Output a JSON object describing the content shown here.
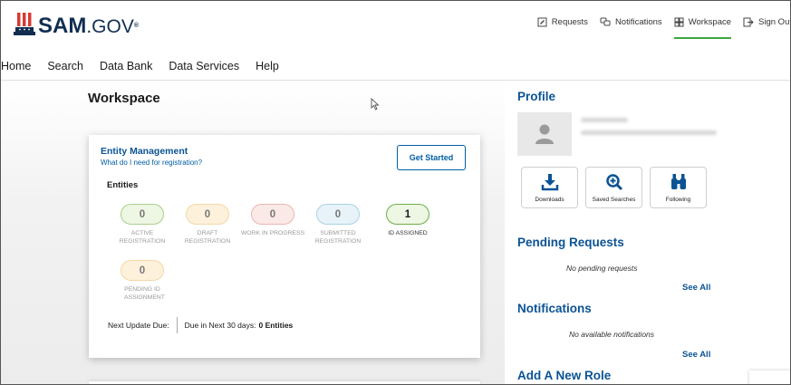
{
  "header": {
    "logo_text": "SAM",
    "logo_suffix": ".GOV",
    "logo_mark": "®",
    "top_links": [
      {
        "label": "Requests",
        "icon": "requests-icon"
      },
      {
        "label": "Notifications",
        "icon": "notifications-icon"
      },
      {
        "label": "Workspace",
        "icon": "workspace-icon",
        "active": true
      },
      {
        "label": "Sign Out",
        "icon": "sign-out-icon"
      }
    ]
  },
  "mainnav": [
    "Home",
    "Search",
    "Data Bank",
    "Data Services",
    "Help"
  ],
  "workspace": {
    "title": "Workspace",
    "entity_card": {
      "title": "Entity Management",
      "link": "What do I need for registration?",
      "button": "Get Started",
      "section": "Entities",
      "stats": [
        {
          "value": "0",
          "label": "ACTIVE REGISTRATION",
          "color": "#eef6e4"
        },
        {
          "value": "0",
          "label": "DRAFT REGISTRATION",
          "color": "#fdf1dc"
        },
        {
          "value": "0",
          "label": "WORK IN PROGRESS",
          "color": "#fbe9e7"
        },
        {
          "value": "0",
          "label": "SUBMITTED REGISTRATION",
          "color": "#e7f3f8"
        },
        {
          "value": "1",
          "label": "ID ASSIGNED",
          "color": "#eef6e4"
        },
        {
          "value": "0",
          "label": "PENDING ID ASSIGNMENT",
          "color": "#fdf1dc"
        }
      ],
      "next_update_label": "Next Update Due:",
      "due_prefix": "Due in Next 30 days: ",
      "due_value": "0 Entities"
    }
  },
  "profile": {
    "title": "Profile",
    "quick_links": [
      {
        "label": "Downloads",
        "icon": "download-icon"
      },
      {
        "label": "Saved Searches",
        "icon": "search-plus-icon"
      },
      {
        "label": "Following",
        "icon": "binoculars-icon"
      }
    ]
  },
  "pending_requests": {
    "title": "Pending Requests",
    "empty": "No pending requests",
    "see_all": "See All"
  },
  "notifications": {
    "title": "Notifications",
    "empty": "No available notifications",
    "see_all": "See All"
  },
  "add_role": {
    "title": "Add A New Role"
  },
  "colors": {
    "brand_navy": "#112e51",
    "link_blue": "#005ea2",
    "active_green": "#3fa63f",
    "flag_red": "#d83933"
  }
}
